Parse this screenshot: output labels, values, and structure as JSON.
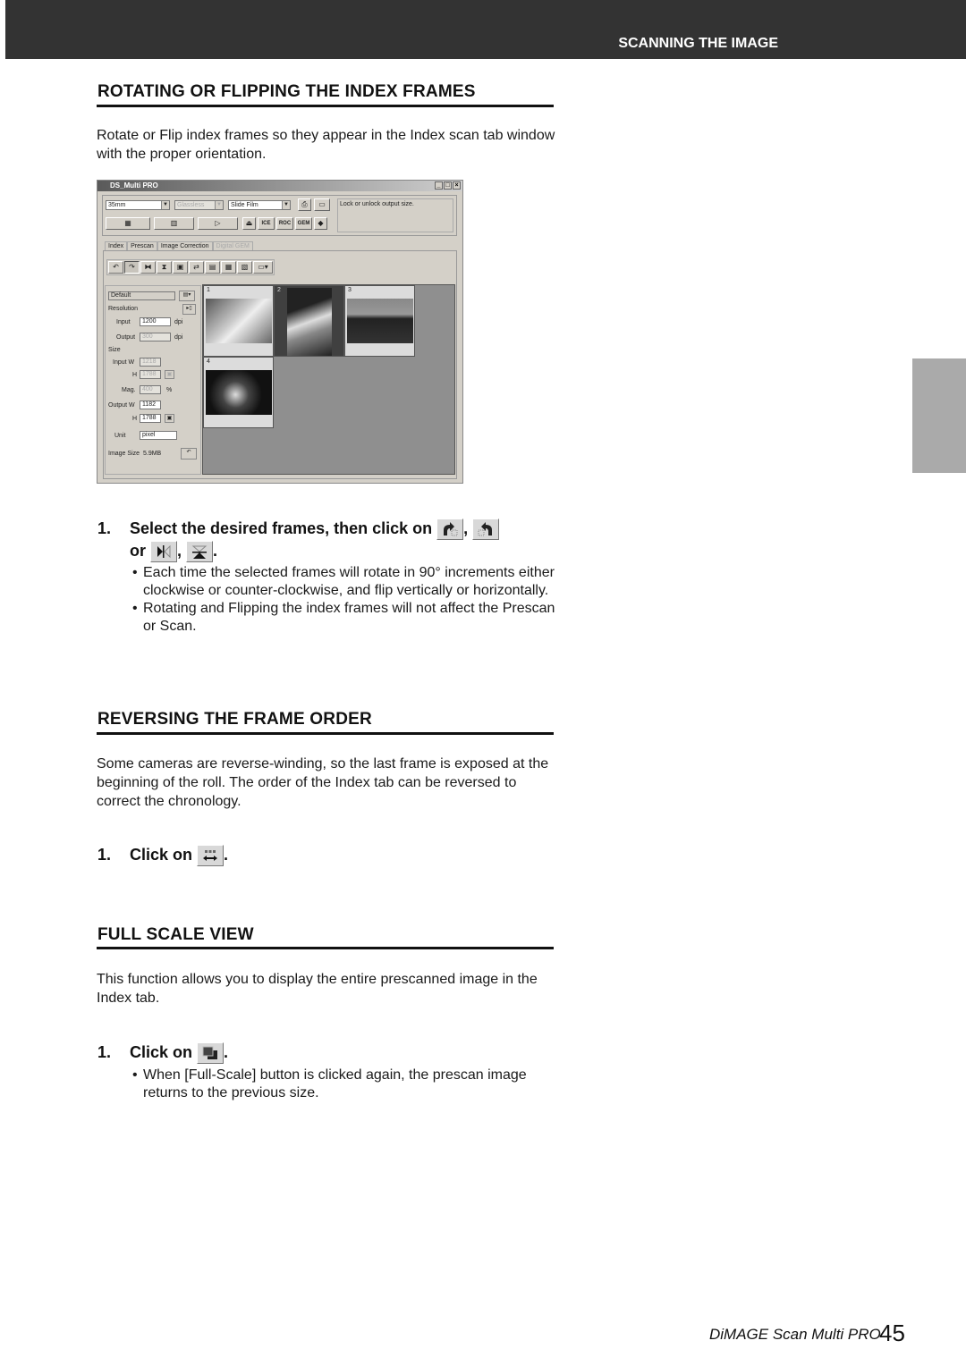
{
  "header": {
    "section_label": "SCANNING THE IMAGE"
  },
  "sections": {
    "rotating": {
      "title": "ROTATING OR FLIPPING THE INDEX FRAMES",
      "intro": "Rotate or Flip index frames so they appear in the Index scan tab window with the proper orientation.",
      "step": {
        "number": "1.",
        "text_a": "Select the desired frames, then click on",
        "sep1": ",",
        "text_b": "or",
        "sep2": ",",
        "end": "."
      },
      "bullets": [
        "Each time the selected frames will rotate in 90° increments either clockwise or counter-clockwise, and flip vertically or horizontally.",
        "Rotating and Flipping the index frames will not affect the Prescan or Scan."
      ],
      "icons": [
        "rotate-left-icon",
        "rotate-right-icon",
        "flip-horizontal-icon",
        "flip-vertical-icon"
      ]
    },
    "reversing": {
      "title": "REVERSING THE FRAME ORDER",
      "intro": "Some cameras are reverse-winding, so the last frame is exposed at the beginning of the roll. The order of the Index tab can be reversed to correct the chronology.",
      "step": {
        "number": "1.",
        "text": "Click on",
        "end": "."
      },
      "icon": "reverse-order-icon"
    },
    "fullscale": {
      "title": "FULL SCALE VIEW",
      "intro": "This function allows you to display the entire prescanned image in the Index tab.",
      "step": {
        "number": "1.",
        "text": "Click on",
        "end": "."
      },
      "bullets": [
        "When [Full-Scale] button is clicked again, the prescan image returns to the previous size."
      ],
      "icon": "full-scale-icon"
    }
  },
  "screenshot": {
    "title": "DS_Multi PRO",
    "controls": [
      "_",
      "□",
      "×"
    ],
    "film_format": "35mm",
    "holder": "Glassless",
    "film_type": "Slide Film",
    "hint_text": "Lock or unlock output size.",
    "scan_buttons": [
      "ICE",
      "ROC",
      "GEM"
    ],
    "tabs": [
      "Index",
      "Prescan",
      "Image Correction",
      "Digital GEM"
    ],
    "settings": {
      "preset": "Default",
      "resolution_label": "Resolution",
      "input_label": "Input",
      "input_dpi": "1200",
      "output_label": "Output",
      "output_dpi": "300",
      "dpi_unit": "dpi",
      "size_label": "Size",
      "input_w_label": "Input W",
      "input_w": "1218",
      "h_label": "H",
      "input_h": "1788",
      "mag_label": "Mag.",
      "mag": "400",
      "mag_unit": "%",
      "output_w_label": "Output W",
      "output_w": "1182",
      "output_h": "1788",
      "unit_label": "Unit",
      "unit": "pixel",
      "image_size_label": "Image Size",
      "image_size": "5.9MB"
    },
    "frames": [
      "1",
      "2",
      "3",
      "4"
    ]
  },
  "footer": {
    "product": "DiMAGE Scan Multi PRO",
    "page_number": "45"
  }
}
